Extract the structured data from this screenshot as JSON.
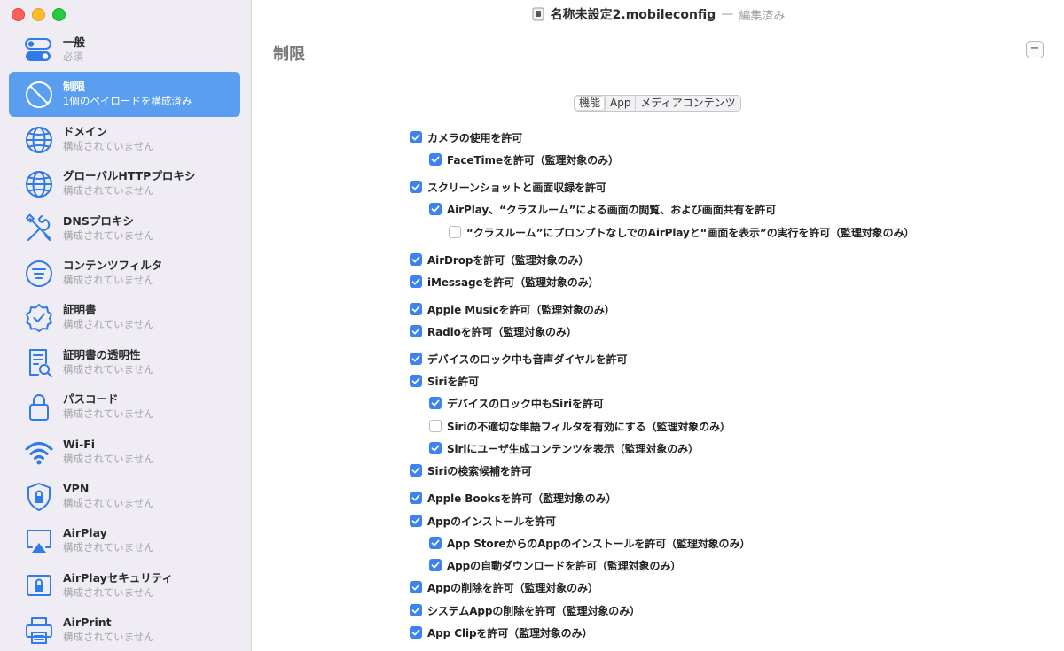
{
  "window": {
    "doc_name": "名称未設定2.mobileconfig",
    "separator": "—",
    "status": "編集済み"
  },
  "sidebar": {
    "items": [
      {
        "title": "一般",
        "subtitle": "必須",
        "icon": "toggle-icon",
        "selected": false
      },
      {
        "title": "制限",
        "subtitle": "1個のペイロードを構成済み",
        "icon": "no-entry-icon",
        "selected": true
      },
      {
        "title": "ドメイン",
        "subtitle": "構成されていません",
        "icon": "globe-icon",
        "selected": false
      },
      {
        "title": "グローバルHTTPプロキシ",
        "subtitle": "構成されていません",
        "icon": "globe-icon",
        "selected": false
      },
      {
        "title": "DNSプロキシ",
        "subtitle": "構成されていません",
        "icon": "tools-icon",
        "selected": false
      },
      {
        "title": "コンテンツフィルタ",
        "subtitle": "構成されていません",
        "icon": "filter-icon",
        "selected": false
      },
      {
        "title": "証明書",
        "subtitle": "構成されていません",
        "icon": "certificate-badge-icon",
        "selected": false
      },
      {
        "title": "証明書の透明性",
        "subtitle": "構成されていません",
        "icon": "document-search-icon",
        "selected": false
      },
      {
        "title": "パスコード",
        "subtitle": "構成されていません",
        "icon": "lock-icon",
        "selected": false
      },
      {
        "title": "Wi-Fi",
        "subtitle": "構成されていません",
        "icon": "wifi-icon",
        "selected": false
      },
      {
        "title": "VPN",
        "subtitle": "構成されていません",
        "icon": "shield-lock-icon",
        "selected": false
      },
      {
        "title": "AirPlay",
        "subtitle": "構成されていません",
        "icon": "airplay-icon",
        "selected": false
      },
      {
        "title": "AirPlayセキュリティ",
        "subtitle": "構成されていません",
        "icon": "airplay-lock-icon",
        "selected": false
      },
      {
        "title": "AirPrint",
        "subtitle": "構成されていません",
        "icon": "printer-icon",
        "selected": false
      }
    ]
  },
  "main": {
    "section_title": "制限",
    "collapse_label": "−",
    "tabs": [
      {
        "label": "機能",
        "active": true
      },
      {
        "label": "App",
        "active": false
      },
      {
        "label": "メディアコンテンツ",
        "active": false
      }
    ],
    "options": [
      {
        "label": "カメラの使用を許可",
        "checked": true,
        "level": 0
      },
      {
        "label": "FaceTimeを許可（監理対象のみ）",
        "checked": true,
        "level": 1
      },
      {
        "label": "スクリーンショットと画面収録を許可",
        "checked": true,
        "level": 0
      },
      {
        "label": "AirPlay、“クラスルーム”による画面の閲覧、および画面共有を許可",
        "checked": true,
        "level": 1
      },
      {
        "label": "“クラスルーム”にプロンプトなしでのAirPlayと“画面を表示”の実行を許可（監理対象のみ）",
        "checked": false,
        "level": 2
      },
      {
        "label": "AirDropを許可（監理対象のみ）",
        "checked": true,
        "level": 0
      },
      {
        "label": "iMessageを許可（監理対象のみ）",
        "checked": true,
        "level": 0
      },
      {
        "label": "Apple Musicを許可（監理対象のみ）",
        "checked": true,
        "level": 0
      },
      {
        "label": "Radioを許可（監理対象のみ）",
        "checked": true,
        "level": 0
      },
      {
        "label": "デバイスのロック中も音声ダイヤルを許可",
        "checked": true,
        "level": 0
      },
      {
        "label": "Siriを許可",
        "checked": true,
        "level": 0
      },
      {
        "label": "デバイスのロック中もSiriを許可",
        "checked": true,
        "level": 1
      },
      {
        "label": "Siriの不適切な単語フィルタを有効にする（監理対象のみ）",
        "checked": false,
        "level": 1
      },
      {
        "label": "Siriにユーザ生成コンテンツを表示（監理対象のみ）",
        "checked": true,
        "level": 1
      },
      {
        "label": "Siriの検索候補を許可",
        "checked": true,
        "level": 0
      },
      {
        "label": "Apple Booksを許可（監理対象のみ）",
        "checked": true,
        "level": 0
      },
      {
        "label": "Appのインストールを許可",
        "checked": true,
        "level": 0
      },
      {
        "label": "App StoreからのAppのインストールを許可（監理対象のみ）",
        "checked": true,
        "level": 1
      },
      {
        "label": "Appの自動ダウンロードを許可（監理対象のみ）",
        "checked": true,
        "level": 1
      },
      {
        "label": "Appの削除を許可（監理対象のみ）",
        "checked": true,
        "level": 0
      },
      {
        "label": "システムAppの削除を許可（監理対象のみ）",
        "checked": true,
        "level": 0
      },
      {
        "label": "App Clipを許可（監理対象のみ）",
        "checked": true,
        "level": 0
      }
    ]
  },
  "colors": {
    "accent": "#3c82f0",
    "selection": "#5a9ef0",
    "sidebar_icon": "#2f7be8"
  }
}
